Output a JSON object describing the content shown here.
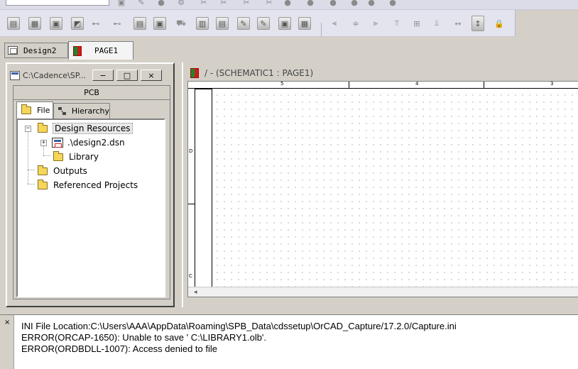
{
  "toolbar": {
    "row1_icons": [
      "save-icon",
      "help-icon",
      "find-icon",
      "annotate-icon",
      "netlist-icon",
      "drc-icon",
      "cross-ref-icon",
      "bom-icon",
      "undo-icon",
      "redo-icon",
      "back-icon",
      "forward-icon"
    ],
    "row2_icons": [
      "library-icon",
      "parts-icon",
      "edit-icon",
      "pin-icon",
      "net-icon",
      "copy-icon",
      "export-icon",
      "cart-icon",
      "properties-icon",
      "tag-icon",
      "note-icon",
      "report-icon",
      "table-icon",
      "align-left-icon",
      "align-center-icon",
      "align-right-icon",
      "align-top-icon",
      "align-middle-icon",
      "align-bottom-icon",
      "distribute-h-icon",
      "distribute-v-icon",
      "lock-icon"
    ]
  },
  "tabs": [
    {
      "label": "Design2",
      "active": false
    },
    {
      "label": "PAGE1",
      "active": true
    }
  ],
  "project": {
    "title": "C:\\Cadence\\SP...",
    "win_buttons": [
      "−",
      "□",
      "×"
    ],
    "category": "PCB",
    "pm_tabs": [
      {
        "label": "File",
        "active": true
      },
      {
        "label": "Hierarchy",
        "active": false
      }
    ],
    "tree": {
      "design_resources": "Design Resources",
      "design_file": ".\\design2.dsn",
      "library": "Library",
      "outputs": "Outputs",
      "referenced_projects": "Referenced Projects",
      "expanded": "−",
      "collapsed": "+"
    }
  },
  "schematic": {
    "title": "/ - (SCHEMATIC1 : PAGE1)",
    "ruler_top": [
      "5",
      "4",
      "3"
    ],
    "ruler_left": [
      "D",
      "C"
    ],
    "scroll_left": "◂"
  },
  "log": {
    "close": "×",
    "lines": [
      "INI File Location:C:\\Users\\AAA\\AppData\\Roaming\\SPB_Data\\cdssetup\\OrCAD_Capture/17.2.0/Capture.ini",
      "ERROR(ORCAP-1650): Unable to save ' C:\\LIBRARY1.olb'.",
      "ERROR(ORDBDLL-1007): Access denied to file"
    ]
  }
}
